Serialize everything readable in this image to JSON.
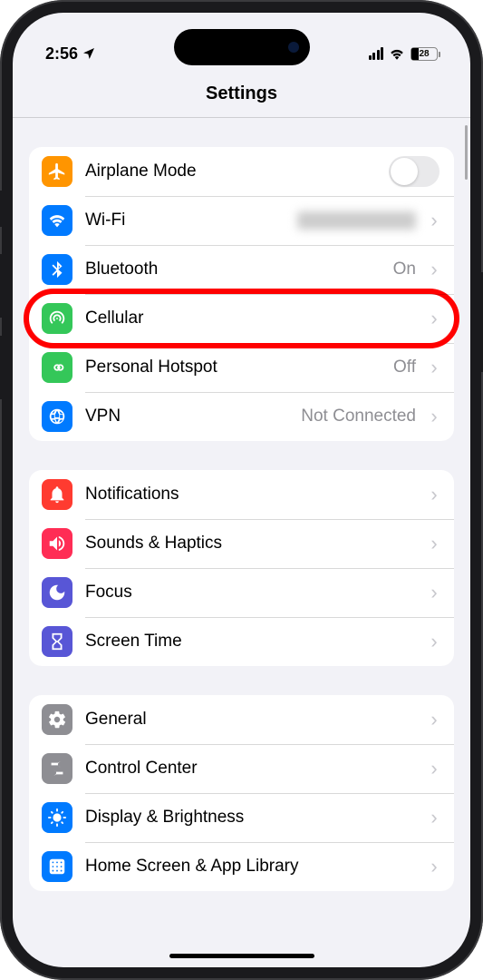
{
  "status": {
    "time": "2:56",
    "battery_pct": "28"
  },
  "header": {
    "title": "Settings"
  },
  "group1": {
    "airplane": {
      "label": "Airplane Mode"
    },
    "wifi": {
      "label": "Wi-Fi",
      "value": "Network"
    },
    "bluetooth": {
      "label": "Bluetooth",
      "value": "On"
    },
    "cellular": {
      "label": "Cellular"
    },
    "hotspot": {
      "label": "Personal Hotspot",
      "value": "Off"
    },
    "vpn": {
      "label": "VPN",
      "value": "Not Connected"
    }
  },
  "group2": {
    "notifications": {
      "label": "Notifications"
    },
    "sounds": {
      "label": "Sounds & Haptics"
    },
    "focus": {
      "label": "Focus"
    },
    "screentime": {
      "label": "Screen Time"
    }
  },
  "group3": {
    "general": {
      "label": "General"
    },
    "controlcenter": {
      "label": "Control Center"
    },
    "display": {
      "label": "Display & Brightness"
    },
    "homescreen": {
      "label": "Home Screen & App Library"
    }
  }
}
